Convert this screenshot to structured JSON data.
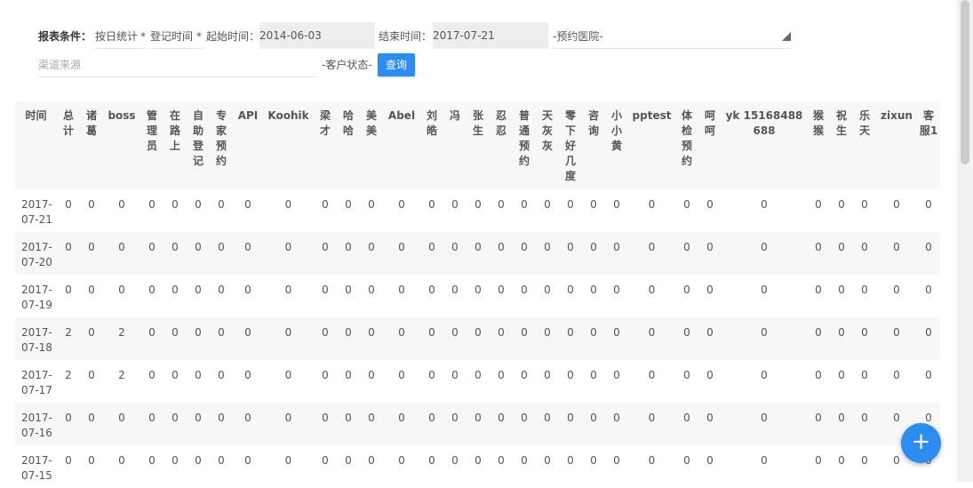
{
  "filters": {
    "label": "报表条件：",
    "stat_mode": "按日统计",
    "star1": "*",
    "time_field": "登记时间",
    "star2": "*",
    "start_label": "起始时间：",
    "start_value": "2014-06-03",
    "end_label": "结束时间：",
    "end_value": "2017-07-21",
    "hospital_select": "-预约医院-",
    "channel_placeholder": "渠道来源",
    "status_select": "-客户状态-",
    "query_button": "查询"
  },
  "table": {
    "headers": [
      "时间",
      "总计",
      "诸葛",
      "boss",
      "管理员",
      "在路上",
      "自助登记",
      "专家预约",
      "API",
      "Koohik",
      "梁才",
      "哈哈",
      "美美",
      "Abel",
      "刘皓",
      "冯",
      "张生",
      "忍忍",
      "普通预约",
      "天灰灰",
      "零下好几度",
      "咨询",
      "小小黄",
      "pptest",
      "体检预约",
      "呵呵",
      "yk 15168488688",
      "猴猴",
      "祝生",
      "乐天",
      "zixun",
      "客服1"
    ],
    "rows": [
      {
        "date": "2017-07-21",
        "values": [
          "0",
          "0",
          "0",
          "0",
          "0",
          "0",
          "0",
          "0",
          "0",
          "0",
          "0",
          "0",
          "0",
          "0",
          "0",
          "0",
          "0",
          "0",
          "0",
          "0",
          "0",
          "0",
          "0",
          "0",
          "0",
          "0",
          "0",
          "0",
          "0",
          "0",
          "0"
        ]
      },
      {
        "date": "2017-07-20",
        "values": [
          "0",
          "0",
          "0",
          "0",
          "0",
          "0",
          "0",
          "0",
          "0",
          "0",
          "0",
          "0",
          "0",
          "0",
          "0",
          "0",
          "0",
          "0",
          "0",
          "0",
          "0",
          "0",
          "0",
          "0",
          "0",
          "0",
          "0",
          "0",
          "0",
          "0",
          "0"
        ]
      },
      {
        "date": "2017-07-19",
        "values": [
          "0",
          "0",
          "0",
          "0",
          "0",
          "0",
          "0",
          "0",
          "0",
          "0",
          "0",
          "0",
          "0",
          "0",
          "0",
          "0",
          "0",
          "0",
          "0",
          "0",
          "0",
          "0",
          "0",
          "0",
          "0",
          "0",
          "0",
          "0",
          "0",
          "0",
          "0"
        ]
      },
      {
        "date": "2017-07-18",
        "values": [
          "2",
          "0",
          "2",
          "0",
          "0",
          "0",
          "0",
          "0",
          "0",
          "0",
          "0",
          "0",
          "0",
          "0",
          "0",
          "0",
          "0",
          "0",
          "0",
          "0",
          "0",
          "0",
          "0",
          "0",
          "0",
          "0",
          "0",
          "0",
          "0",
          "0",
          "0"
        ]
      },
      {
        "date": "2017-07-17",
        "values": [
          "2",
          "0",
          "2",
          "0",
          "0",
          "0",
          "0",
          "0",
          "0",
          "0",
          "0",
          "0",
          "0",
          "0",
          "0",
          "0",
          "0",
          "0",
          "0",
          "0",
          "0",
          "0",
          "0",
          "0",
          "0",
          "0",
          "0",
          "0",
          "0",
          "0",
          "0"
        ]
      },
      {
        "date": "2017-07-16",
        "values": [
          "0",
          "0",
          "0",
          "0",
          "0",
          "0",
          "0",
          "0",
          "0",
          "0",
          "0",
          "0",
          "0",
          "0",
          "0",
          "0",
          "0",
          "0",
          "0",
          "0",
          "0",
          "0",
          "0",
          "0",
          "0",
          "0",
          "0",
          "0",
          "0",
          "0",
          "0"
        ]
      },
      {
        "date": "2017-07-15",
        "values": [
          "0",
          "0",
          "0",
          "0",
          "0",
          "0",
          "0",
          "0",
          "0",
          "0",
          "0",
          "0",
          "0",
          "0",
          "0",
          "0",
          "0",
          "0",
          "0",
          "0",
          "0",
          "0",
          "0",
          "0",
          "0",
          "0",
          "0",
          "0",
          "0",
          "0",
          "0"
        ]
      }
    ]
  },
  "fab": {
    "icon": "plus-icon",
    "label": "+"
  },
  "colors": {
    "accent": "#2d8cf0",
    "stripe": "#f7f7f7",
    "date_bg": "#eeeeee"
  }
}
